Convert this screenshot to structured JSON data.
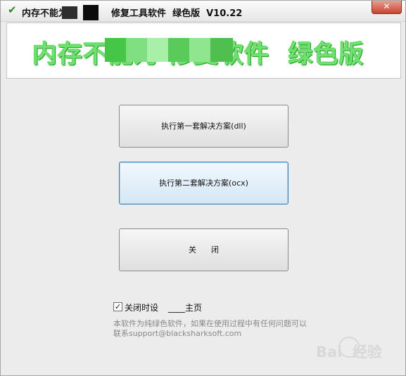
{
  "window": {
    "title_part1": "内存不能为",
    "title_part2": "修复工具软件  绿色版  V10.22",
    "close_label": "✕"
  },
  "banner": {
    "text": "内存不能为 修复软件  绿色版"
  },
  "buttons": {
    "solution1": "执行第一套解决方案(dll)",
    "solution2": "执行第二套解决方案(ocx)",
    "close": "关      闭"
  },
  "options": {
    "close_setting_label": "关闭时设",
    "close_setting_checked": "✓",
    "homepage_label": "____主页"
  },
  "info": {
    "line1": "本软件为纯绿色软件，如果在使用过程中有任何问题可以",
    "line2": "联系support@blacksharksoft.com"
  },
  "watermark": {
    "text": "Bai  经验"
  },
  "colors": {
    "banner_green": "#70e070",
    "focus_border": "#3c7fb1",
    "close_red": "#c8442f"
  }
}
